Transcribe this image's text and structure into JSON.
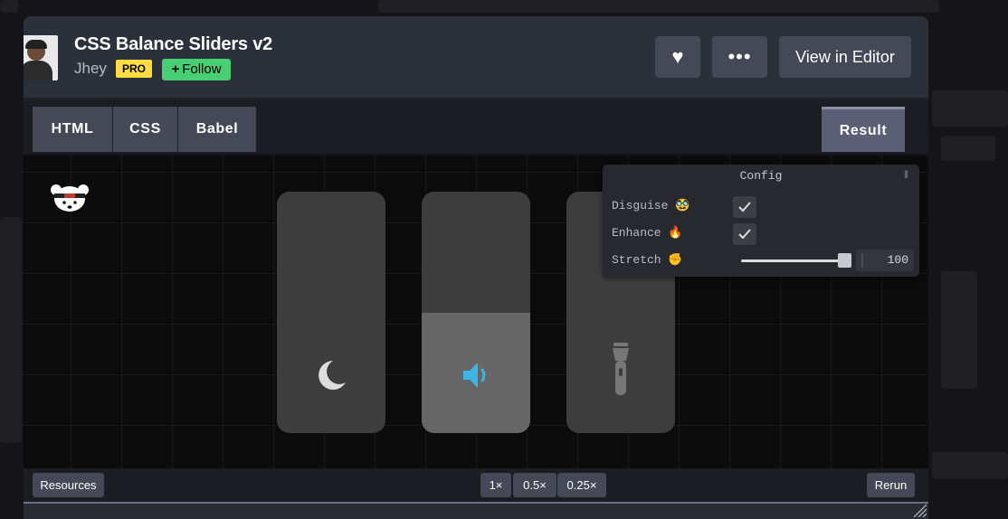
{
  "pen": {
    "title": "CSS Balance Sliders v2",
    "author": "Jhey",
    "pro_badge": "PRO",
    "follow_label": "Follow",
    "avatar_icon": "user-avatar"
  },
  "header_actions": {
    "like_icon": "heart-icon",
    "more_icon": "more-icon",
    "more_label": "•••",
    "heart_label": "♥",
    "view_in_editor": "View in Editor"
  },
  "editor_tabs": [
    "HTML",
    "CSS",
    "Babel"
  ],
  "result_tab": "Result",
  "sliders": [
    {
      "icon": "moon-icon",
      "level": 0.0
    },
    {
      "icon": "volume-icon",
      "level": 0.5,
      "accent": "#3db6e6"
    },
    {
      "icon": "flashlight-icon",
      "level": 0.0
    }
  ],
  "config": {
    "title": "Config",
    "collapse_glyph": "⦀",
    "rows": [
      {
        "label": "Disguise 🥸",
        "type": "checkbox",
        "checked": true
      },
      {
        "label": "Enhance 🔥",
        "type": "checkbox",
        "checked": true
      },
      {
        "label": "Stretch ✊",
        "type": "range",
        "value": "100",
        "fraction": 1.0
      }
    ]
  },
  "footer": {
    "resources": "Resources",
    "zoom": [
      "1×",
      "0.5×",
      "0.25×"
    ],
    "rerun": "Rerun"
  },
  "colors": {
    "follow": "#47cf73",
    "pro": "#ffdd40",
    "accent_volume": "#3db6e6"
  }
}
